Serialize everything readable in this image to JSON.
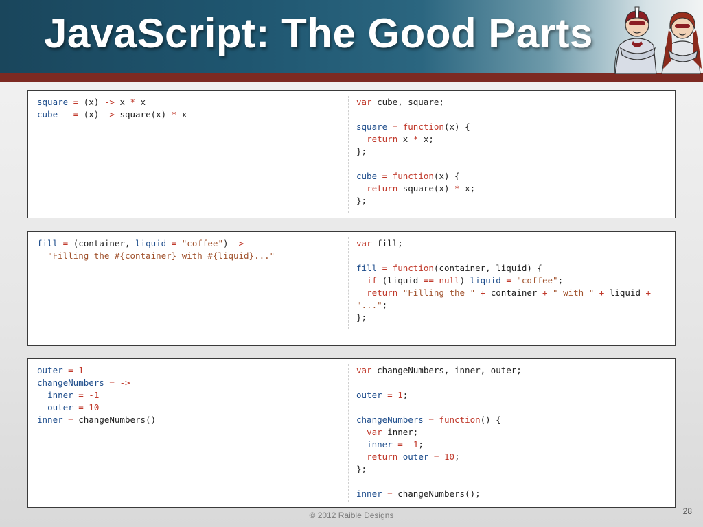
{
  "slide": {
    "title": "JavaScript: The Good Parts",
    "footer": "© 2012 Raible Designs",
    "page_number": "28"
  },
  "colors": {
    "header_dark": "#1a465c",
    "header_stripe": "#7d2a22",
    "keyword": "#c0392b",
    "identifier": "#1f4e8c",
    "string": "#a0522d"
  },
  "header_art": {
    "icon": "superhero-duo-illustration"
  },
  "panels": [
    {
      "coffeescript": [
        "square = (x) -> x * x",
        "cube   = (x) -> square(x) * x"
      ],
      "javascript": [
        "var cube, square;",
        "",
        "square = function(x) {",
        "  return x * x;",
        "};",
        "",
        "cube = function(x) {",
        "  return square(x) * x;",
        "};"
      ]
    },
    {
      "coffeescript": [
        "fill = (container, liquid = \"coffee\") ->",
        "  \"Filling the #{container} with #{liquid}...\""
      ],
      "javascript": [
        "var fill;",
        "",
        "fill = function(container, liquid) {",
        "  if (liquid == null) liquid = \"coffee\";",
        "  return \"Filling the \" + container + \" with \" + liquid +",
        "\"...\";",
        "};"
      ]
    },
    {
      "coffeescript": [
        "outer = 1",
        "changeNumbers = ->",
        "  inner = -1",
        "  outer = 10",
        "inner = changeNumbers()"
      ],
      "javascript": [
        "var changeNumbers, inner, outer;",
        "",
        "outer = 1;",
        "",
        "changeNumbers = function() {",
        "  var inner;",
        "  inner = -1;",
        "  return outer = 10;",
        "};",
        "",
        "inner = changeNumbers();"
      ]
    }
  ]
}
